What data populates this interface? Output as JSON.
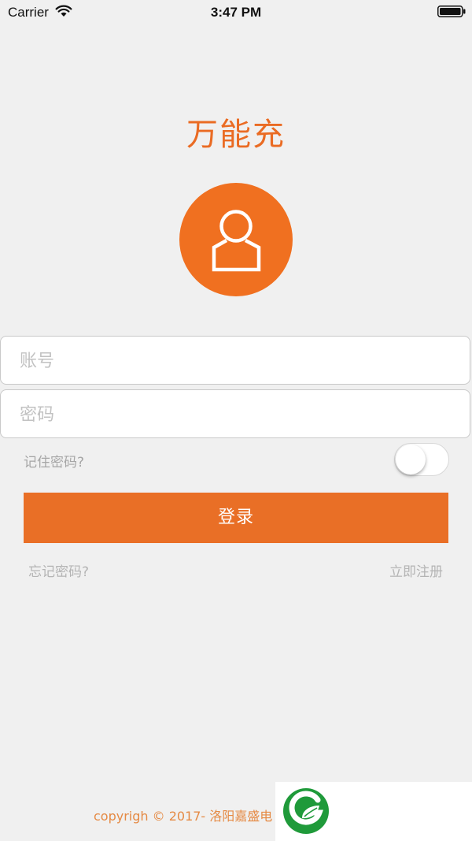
{
  "status_bar": {
    "carrier": "Carrier",
    "time": "3:47 PM",
    "wifi_icon": "wifi-icon",
    "battery_icon": "battery-icon"
  },
  "app": {
    "title": "万能充",
    "avatar_icon": "user-icon"
  },
  "form": {
    "account_placeholder": "账号",
    "account_value": "",
    "password_placeholder": "密码",
    "password_value": "",
    "remember_label": "记住密码?",
    "remember_on": false,
    "login_label": "登录",
    "forgot_label": "忘记密码?",
    "register_label": "立即注册"
  },
  "footer": {
    "copyright": "copyrigh © 2017- 洛阳嘉盛电",
    "watermark_icon": "leaf-logo-icon"
  },
  "colors": {
    "accent": "#e96f26",
    "background": "#f0f0f0",
    "placeholder": "#c2c2c2",
    "muted_text": "#a6a6a6",
    "watermark_green": "#1f9a3a"
  }
}
